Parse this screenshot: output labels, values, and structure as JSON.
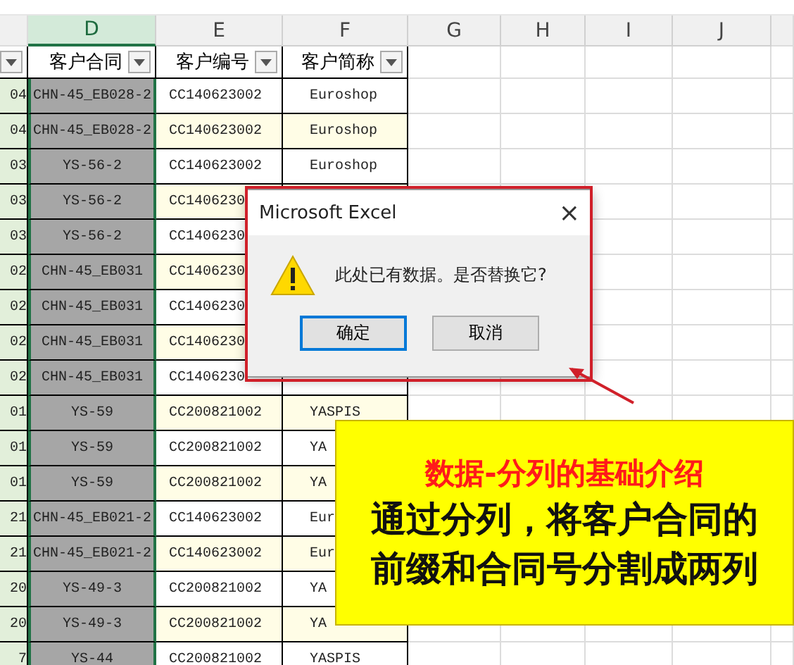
{
  "column_letters": [
    {
      "label": "D",
      "selected": true
    },
    {
      "label": "E",
      "selected": false
    },
    {
      "label": "F",
      "selected": false
    },
    {
      "label": "G",
      "selected": false
    },
    {
      "label": "H",
      "selected": false
    },
    {
      "label": "I",
      "selected": false
    },
    {
      "label": "J",
      "selected": false
    }
  ],
  "headers": [
    "客户合同",
    "客户编号",
    "客户简称"
  ],
  "rows": [
    {
      "c": "04",
      "d": "CHN-45_EB028-2",
      "e": "CC140623002",
      "f": "Euroshop"
    },
    {
      "c": "04",
      "d": "CHN-45_EB028-2",
      "e": "CC140623002",
      "f": "Euroshop"
    },
    {
      "c": "03",
      "d": "YS-56-2",
      "e": "CC140623002",
      "f": "Euroshop"
    },
    {
      "c": "03",
      "d": "YS-56-2",
      "e": "CC1406230"
    },
    {
      "c": "03",
      "d": "YS-56-2",
      "e": "CC1406230"
    },
    {
      "c": "02",
      "d": "CHN-45_EB031",
      "e": "CC1406230"
    },
    {
      "c": "02",
      "d": "CHN-45_EB031",
      "e": "CC1406230"
    },
    {
      "c": "02",
      "d": "CHN-45_EB031",
      "e": "CC1406230"
    },
    {
      "c": "02",
      "d": "CHN-45_EB031",
      "e": "CC1406230"
    },
    {
      "c": "01",
      "d": "YS-59",
      "e": "CC200821002",
      "f": "YASPIS"
    },
    {
      "c": "01",
      "d": "YS-59",
      "e": "CC200821002",
      "f": "YA"
    },
    {
      "c": "01",
      "d": "YS-59",
      "e": "CC200821002",
      "f": "YA"
    },
    {
      "c": "21",
      "d": "CHN-45_EB021-2",
      "e": "CC140623002",
      "f": "Eur"
    },
    {
      "c": "21",
      "d": "CHN-45_EB021-2",
      "e": "CC140623002",
      "f": "Eur"
    },
    {
      "c": "20",
      "d": "YS-49-3",
      "e": "CC200821002",
      "f": "YA"
    },
    {
      "c": "20",
      "d": "YS-49-3",
      "e": "CC200821002",
      "f": "YA"
    },
    {
      "c": "7",
      "d": "YS-44",
      "e": "CC200821002",
      "f": "YASPIS"
    }
  ],
  "dialog": {
    "title": "Microsoft Excel",
    "close": "×",
    "message": "此处已有数据。是否替换它?",
    "buttons": [
      {
        "label": "确定",
        "focused": true
      },
      {
        "label": "取消",
        "focused": false
      }
    ]
  },
  "callout": {
    "title": "数据-分列的基础介绍",
    "lines": [
      "通过分列，将客户合同的",
      "前缀和合同号分割成两列"
    ]
  }
}
